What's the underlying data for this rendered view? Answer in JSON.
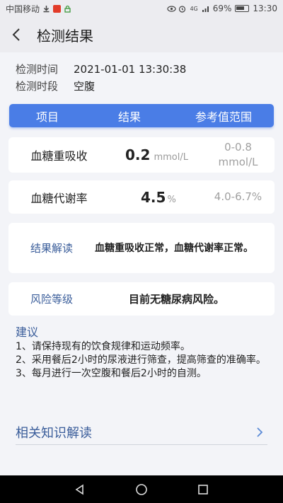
{
  "status_bar": {
    "carrier": "中国移动",
    "signal": "4G",
    "battery": "69%",
    "time": "13:30"
  },
  "header": {
    "title": "检测结果"
  },
  "meta": {
    "time_label": "检测时间",
    "time_value": "2021-01-01 13:30:38",
    "period_label": "检测时段",
    "period_value": "空腹"
  },
  "table": {
    "headers": [
      "项目",
      "结果",
      "参考值范围"
    ],
    "rows": [
      {
        "name": "血糖重吸收",
        "value": "0.2",
        "unit": "mmol/L",
        "range_line1": "0-0.8",
        "range_line2": "mmol/L"
      },
      {
        "name": "血糖代谢率",
        "value": "4.5",
        "unit": "%",
        "range_line1": "4.0-6.7%",
        "range_line2": ""
      }
    ]
  },
  "interpretation": {
    "label": "结果解读",
    "text": "血糖重吸收正常，血糖代谢率正常。"
  },
  "risk": {
    "label": "风险等级",
    "text": "目前无糖尿病风险。"
  },
  "advice": {
    "title": "建议",
    "items": [
      "1、请保持现有的饮食规律和运动频率。",
      "2、采用餐后2小时的尿液进行筛查，提高筛查的准确率。",
      "3、每月进行一次空腹和餐后2小时的自测。"
    ]
  },
  "knowledge": {
    "label": "相关知识解读"
  },
  "colors": {
    "accent": "#4a7de6",
    "label_blue": "#3a5d9a"
  }
}
